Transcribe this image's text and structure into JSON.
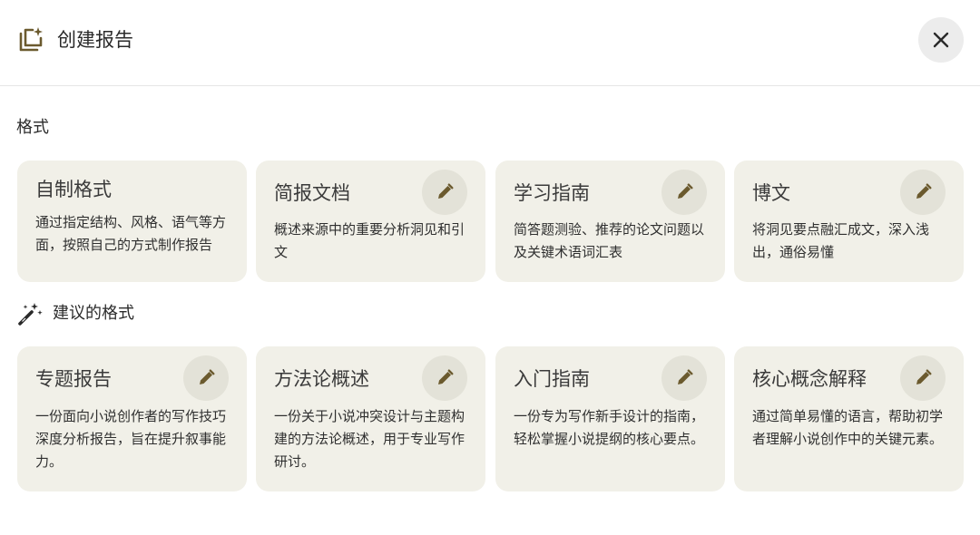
{
  "header": {
    "title": "创建报告",
    "icon": "report-sparkle-icon",
    "close_icon": "close-icon"
  },
  "sections": {
    "formats_label": "格式",
    "suggested_label": "建议的格式"
  },
  "format_cards": [
    {
      "title": "自制格式",
      "desc": "通过指定结构、风格、语气等方面，按照自己的方式制作报告",
      "editable": false
    },
    {
      "title": "简报文档",
      "desc": "概述来源中的重要分析洞见和引文",
      "editable": true
    },
    {
      "title": "学习指南",
      "desc": "简答题测验、推荐的论文问题以及关键术语词汇表",
      "editable": true
    },
    {
      "title": "博文",
      "desc": "将洞见要点融汇成文，深入浅出，通俗易懂",
      "editable": true
    }
  ],
  "suggested_cards": [
    {
      "title": "专题报告",
      "desc": "一份面向小说创作者的写作技巧深度分析报告，旨在提升叙事能力。",
      "editable": true
    },
    {
      "title": "方法论概述",
      "desc": "一份关于小说冲突设计与主题构建的方法论概述，用于专业写作研讨。",
      "editable": true
    },
    {
      "title": "入门指南",
      "desc": "一份专为写作新手设计的指南，轻松掌握小说提纲的核心要点。",
      "editable": true
    },
    {
      "title": "核心概念解释",
      "desc": "通过简单易懂的语言，帮助初学者理解小说创作中的关键元素。",
      "editable": true
    }
  ],
  "colors": {
    "card_bg": "#f1f0e8",
    "edit_btn_bg": "#e3e2d8",
    "accent_brown": "#6b5a2e"
  }
}
